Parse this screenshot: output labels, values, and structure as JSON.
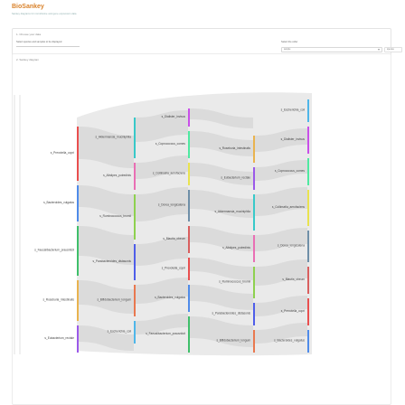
{
  "app": {
    "title": "BioSankey",
    "subtitle": "Sankey diagrams for microbiome and gene expression data"
  },
  "settings": {
    "panel_label": "1. Choose your data",
    "left_field_label": "Select species and samples to be displayed",
    "right_field_label": "Select the order",
    "select_value": "sample",
    "right_select_value": "species",
    "submit_label": "Submit"
  },
  "diagram": {
    "panel_label": "2. Sankey diagram",
    "nodes": [
      {
        "label": "s_Prevotella_copri",
        "color": "#e94f4f"
      },
      {
        "label": "s_Bacteroides_vulgatus",
        "color": "#4f8be9"
      },
      {
        "label": "s_Faecalibacterium_prausnitzii",
        "color": "#3fbf6a"
      },
      {
        "label": "s_Roseburia_intestinalis",
        "color": "#e9b34f"
      },
      {
        "label": "s_Eubacterium_rectale",
        "color": "#9b59e9"
      },
      {
        "label": "s_Akkermansia_muciniphila",
        "color": "#38c9c9"
      },
      {
        "label": "s_Alistipes_putredinis",
        "color": "#e96fb4"
      },
      {
        "label": "s_Ruminococcus_bromii",
        "color": "#8ed14f"
      },
      {
        "label": "s_Parabacteroides_distasonis",
        "color": "#4f5ee9"
      },
      {
        "label": "s_Bifidobacterium_longum",
        "color": "#e9784f"
      },
      {
        "label": "s_Escherichia_coli",
        "color": "#4fb6e9"
      },
      {
        "label": "s_Dialister_invisus",
        "color": "#c94fe9"
      },
      {
        "label": "s_Coprococcus_comes",
        "color": "#4fe9a1"
      },
      {
        "label": "s_Collinsella_aerofaciens",
        "color": "#e9e34f"
      },
      {
        "label": "s_Dorea_longicatena",
        "color": "#6f8fa8"
      },
      {
        "label": "s_Blautia_obeum",
        "color": "#d95f5f"
      }
    ]
  }
}
